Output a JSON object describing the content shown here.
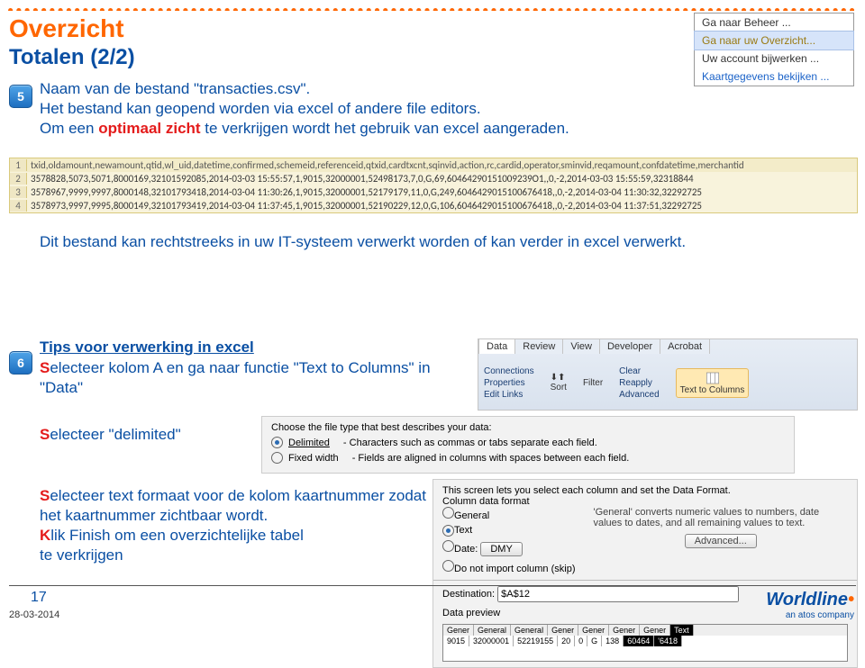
{
  "decor": "●●●●●●●●●●●●●●●●●●●●●●●●●●●●●●●●●●●●●●●●●●●●●●●●●●●●●●●●●●●●●●●●●●●●●●●●●●●●●●●●●●●●●●●●●●●●●●●●●●●●●●●●●●●●●●●●●●●●●●●●",
  "title": "Overzicht",
  "subtitle": "Totalen (2/2)",
  "badge5": "5",
  "badge6": "6",
  "p5_l1": "Naam van de bestand \"transacties.csv\".",
  "p5_l2": "Het bestand kan geopend worden via excel of andere file editors.",
  "p5_l3a": "Om  een",
  "p5_l3b": "optimaal zicht",
  "p5_l3c": " te verkrijgen wordt het gebruik van excel aangeraden.",
  "excel_header": "txid,oldamount,newamount,qtid,wl_uid,datetime,confirmed,schemeid,referenceid,qtxid,cardtxcnt,sqinvid,action,rc,cardid,operator,sminvid,reqamount,confdatetime,merchantid",
  "excel_r2": "3578828,5073,5071,8000169,32101592085,2014-03-03 15:55:57,1,9015,32000001,52498173,7,0,G,69,60464290151009239O1,,0,-2,2014-03-03 15:55:59,32318844",
  "excel_r3": "3578967,9999,9997,8000148,32101793418,2014-03-04 11:30:26,1,9015,32000001,52179179,11,0,G,249,6046429015100676418,,0,-2,2014-03-04 11:30:32,32292725",
  "excel_r4": "3578973,9997,9995,8000149,32101793419,2014-03-04 11:37:45,1,9015,32000001,52190229,12,0,G,106,6046429015100676418,,0,-2,2014-03-04 11:37:51,32292725",
  "p_after": "Dit bestand kan rechtstreeks in uw IT-systeem verwerkt worden of kan verder in excel verwerkt.",
  "tips_head": "Tips voor verwerking in excel",
  "p6_l1a": "S",
  "p6_l1b": "electeer kolom A en ga naar functie \"Text to Columns\" in \"Data\"",
  "p6_l2a": "S",
  "p6_l2b": "electeer \"delimited\"",
  "p6_l3a": "S",
  "p6_l3b": "electeer text formaat voor de kolom kaartnummer zodat het kaartnummer zichtbaar wordt.",
  "p6_l4a": "K",
  "p6_l4b": "lik Finish om een overzichtelijke tabel",
  "p6_l5": "te verkrijgen",
  "ribbon": {
    "tabs": {
      "data": "Data",
      "review": "Review",
      "view": "View",
      "dev": "Developer",
      "acrobat": "Acrobat"
    },
    "conn": "Connections",
    "prop": "Properties",
    "edit": "Edit Links",
    "sort": "Sort",
    "filter": "Filter",
    "clear": "Clear",
    "reapply": "Reapply",
    "adv": "Advanced",
    "t2c": "Text to Columns"
  },
  "wizard1": {
    "intro": "Choose the file type that best describes your data:",
    "opt1_label": "Delimited",
    "opt1_desc": "- Characters such as commas or tabs separate each field.",
    "opt2_label": "Fixed width",
    "opt2_desc": "- Fields are aligned in columns with spaces between each field."
  },
  "wizard2": {
    "intro": "This screen lets you select each column and set the Data Format.",
    "group": "Column data format",
    "g": "General",
    "t": "Text",
    "d": "Date:",
    "dmy": "DMY",
    "skip": "Do not import column (skip)",
    "desc": "'General' converts numeric values to numbers, date values to dates, and all remaining values to text.",
    "adv": "Advanced...",
    "dest_l": "Destination:",
    "dest_v": "$A$12",
    "prev": "Data preview",
    "ph": [
      "Gener",
      "General",
      "General",
      "Gener",
      "Gener",
      "Gener",
      "Gener",
      "Text"
    ],
    "pr": [
      "9015",
      "32000001",
      "52219155",
      "20",
      "0",
      "G",
      "138",
      "60464",
      "'6418"
    ]
  },
  "menu": {
    "a": "Ga naar Beheer ...",
    "b": "Ga naar uw Overzicht...",
    "c": "Uw account bijwerken ...",
    "d": "Kaartgegevens bekijken ..."
  },
  "page": "17",
  "date": "28-03-2014",
  "logo": {
    "w": "Worldline",
    "tag": "an atos company"
  }
}
